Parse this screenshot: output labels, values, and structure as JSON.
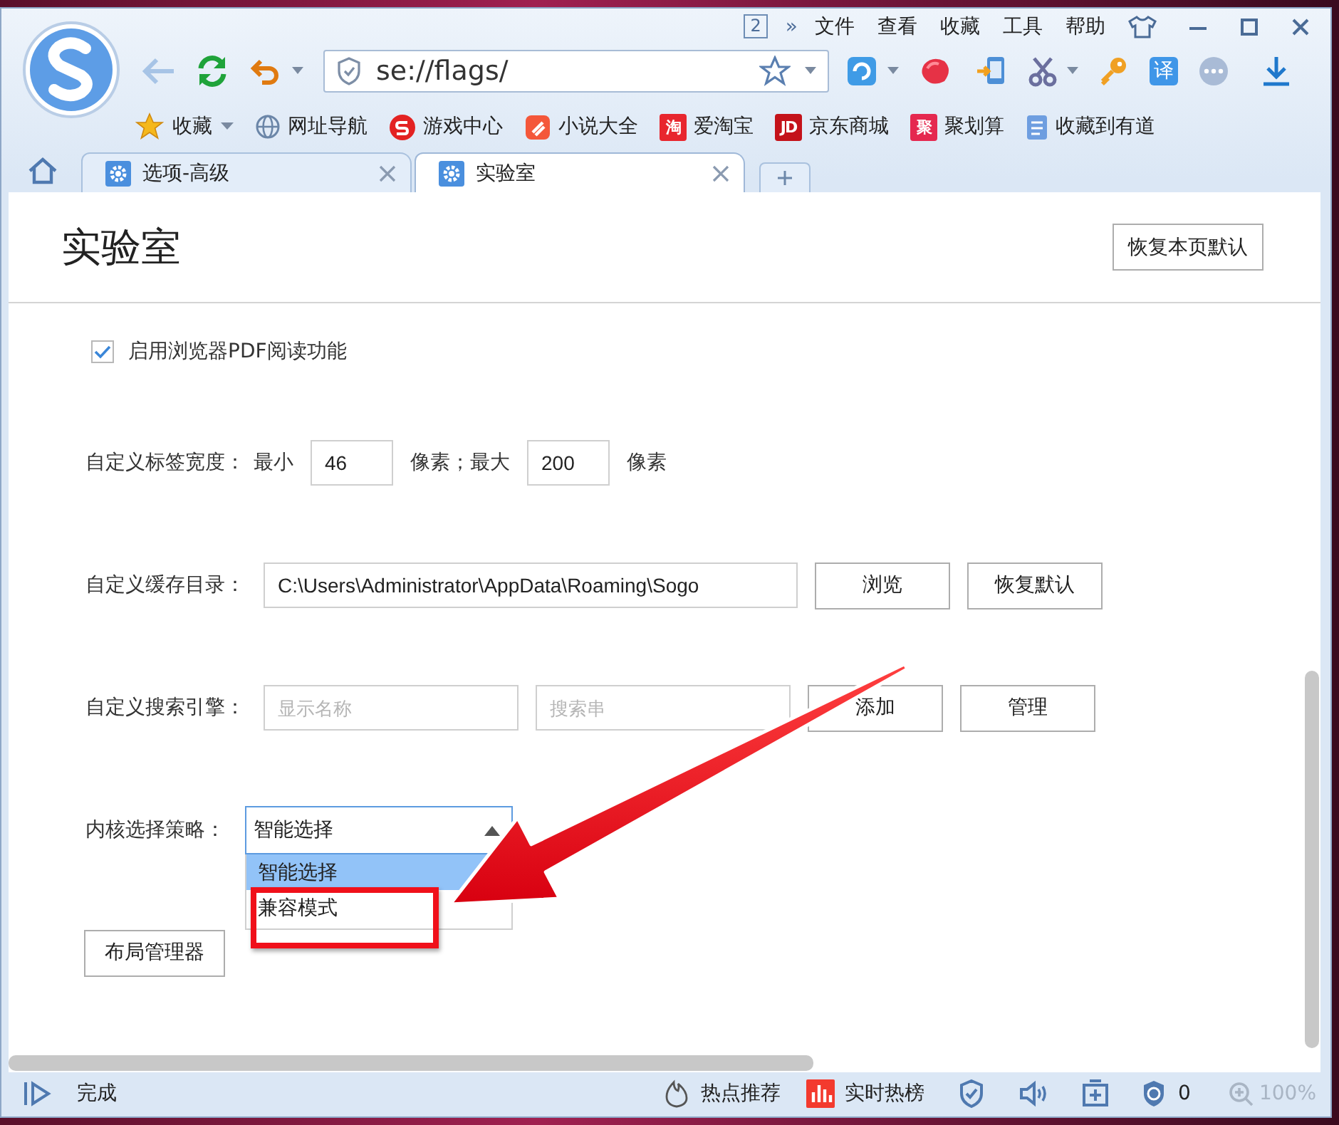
{
  "window": {
    "window_count": "2",
    "overflow": "»",
    "menu": [
      "文件",
      "查看",
      "收藏",
      "工具",
      "帮助"
    ]
  },
  "toolbar": {
    "address": "se://flags/",
    "translate_label": "译"
  },
  "bookmarks": [
    {
      "label": "收藏",
      "kind": "favorites"
    },
    {
      "label": "网址导航",
      "kind": "globe"
    },
    {
      "label": "游戏中心",
      "kind": "game"
    },
    {
      "label": "小说大全",
      "kind": "novel"
    },
    {
      "label": "爱淘宝",
      "kind": "badge",
      "icon_text": "淘",
      "color": "#e8262e"
    },
    {
      "label": "京东商城",
      "kind": "badge",
      "icon_text": "JD",
      "color": "#c4121a"
    },
    {
      "label": "聚划算",
      "kind": "badge",
      "icon_text": "聚",
      "color": "#e5284f"
    },
    {
      "label": "收藏到有道",
      "kind": "note"
    }
  ],
  "tabs": [
    {
      "label": "选项-高级",
      "selected": false
    },
    {
      "label": "实验室",
      "selected": true
    }
  ],
  "page": {
    "title": "实验室",
    "reset_button": "恢复本页默认",
    "pdf_option": {
      "label": "启用浏览器PDF阅读功能",
      "checked": true
    },
    "tab_width": {
      "label": "自定义标签宽度：",
      "min_label": "最小",
      "min_value": "46",
      "middle_label": "像素；最大",
      "max_value": "200",
      "unit": "像素"
    },
    "cache_dir": {
      "label": "自定义缓存目录：",
      "value": "C:\\Users\\Administrator\\AppData\\Roaming\\Sogo",
      "buttons": [
        "浏览",
        "恢复默认"
      ]
    },
    "search_engine": {
      "label": "自定义搜索引擎：",
      "name_placeholder": "显示名称",
      "query_placeholder": "搜索串",
      "buttons": [
        "添加",
        "管理"
      ]
    },
    "kernel": {
      "label": "内核选择策略：",
      "value": "智能选择",
      "expanded": true,
      "options": [
        {
          "label": "智能选择",
          "selected": true
        },
        {
          "label": "兼容模式",
          "selected": false
        }
      ]
    },
    "layout_button": "布局管理器"
  },
  "status_bar": {
    "status": "完成",
    "items": [
      {
        "label": "热点推荐",
        "kind": "flame"
      },
      {
        "label": "实时热榜",
        "kind": "chart"
      }
    ],
    "ad_count": "0",
    "zoom": "100%"
  }
}
